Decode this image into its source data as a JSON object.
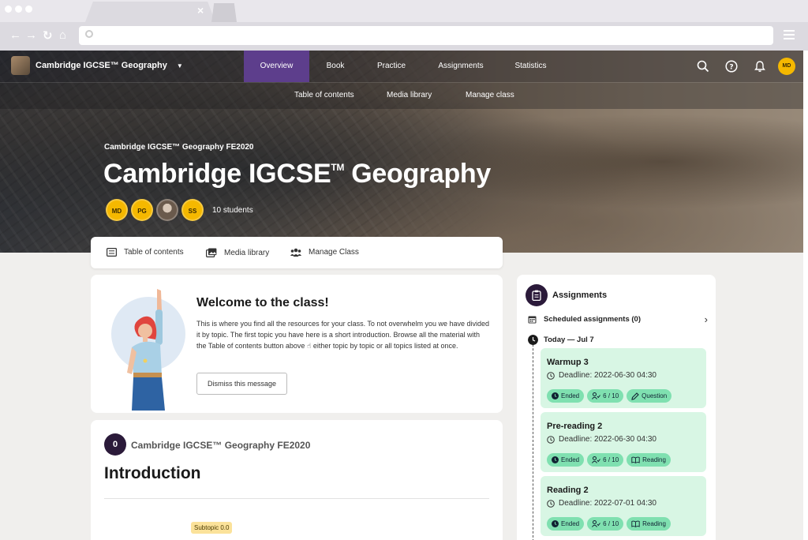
{
  "browser": {
    "tab_close": "×"
  },
  "app": {
    "course_name": "Cambridge IGCSE™ Geography",
    "nav": [
      "Overview",
      "Book",
      "Practice",
      "Assignments",
      "Statistics"
    ],
    "active_nav": "Overview",
    "subnav": [
      "Table of contents",
      "Media library",
      "Manage class"
    ],
    "user_initials": "MD"
  },
  "hero": {
    "course_code": "Cambridge IGCSE™ Geography FE2020",
    "title": "Cambridge IGCSE",
    "title_mark": "TM",
    "title_rest": " Geography",
    "avatars": [
      "MD",
      "PG",
      "",
      "SS"
    ],
    "students": "10 students"
  },
  "tabs": [
    {
      "label": "Table of contents",
      "icon": "list-icon"
    },
    {
      "label": "Media library",
      "icon": "media-icon"
    },
    {
      "label": "Manage Class",
      "icon": "users-icon"
    }
  ],
  "welcome": {
    "title": "Welcome to the class!",
    "body": "This is where you find all the resources for your class. To not overwhelm you we have divided it by topic. The first topic you have here is a short introduction. Browse all the material with the Table of contents button above ☝ either topic by topic or all topics listed at once.",
    "dismiss": "Dismiss this message"
  },
  "intro": {
    "number": "0",
    "code": "Cambridge IGCSE™ Geography FE2020",
    "title": "Introduction",
    "subtopic": "Subtopic 0.0"
  },
  "assignments": {
    "title": "Assignments",
    "scheduled": "Scheduled assignments (0)",
    "today": "Today — Jul 7",
    "items": [
      {
        "title": "Warmup 3",
        "deadline": "Deadline: 2022-06-30 04:30",
        "status": "Ended",
        "count": "6 / 10",
        "type": "Question"
      },
      {
        "title": "Pre-reading 2",
        "deadline": "Deadline: 2022-06-30 04:30",
        "status": "Ended",
        "count": "6 / 10",
        "type": "Reading"
      },
      {
        "title": "Reading 2",
        "deadline": "Deadline: 2022-07-01 04:30",
        "status": "Ended",
        "count": "6 / 10",
        "type": "Reading"
      }
    ]
  },
  "colors": {
    "accent": "#5d3e8c",
    "avatar": "#f5b800",
    "assignment_card": "#d8f6e4",
    "chip": "#7fe0b0"
  }
}
